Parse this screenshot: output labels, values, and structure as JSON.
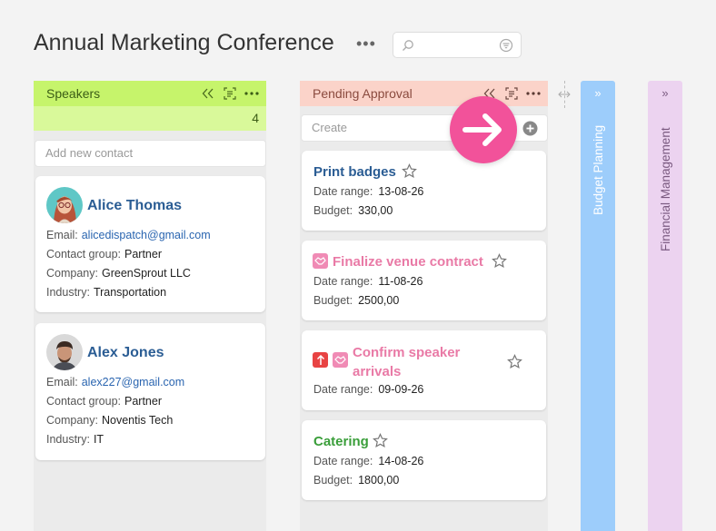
{
  "board": {
    "title": "Annual Marketing Conference",
    "menu_glyph": "•••",
    "search_placeholder": ""
  },
  "columns": {
    "speakers": {
      "title": "Speakers",
      "count": "4",
      "add_placeholder": "Add new contact",
      "color": "#c6f46b"
    },
    "pending": {
      "title": "Pending Approval",
      "create_placeholder": "Create",
      "color": "#fbd3c9"
    },
    "budget": {
      "title": "Budget Planning",
      "chevron": "»",
      "color": "#9dcdfb"
    },
    "financial": {
      "title": "Financial Management",
      "chevron": "»",
      "color": "#ecd3f0"
    }
  },
  "contacts": [
    {
      "name": "Alice Thomas",
      "email_label": "Email:",
      "email": "alicedispatch@gmail.com",
      "group_label": "Contact group:",
      "group": "Partner",
      "company_label": "Company:",
      "company": "GreenSprout LLC",
      "industry_label": "Industry:",
      "industry": "Transportation"
    },
    {
      "name": "Alex Jones",
      "email_label": "Email:",
      "email": "alex227@gmail.com",
      "group_label": "Contact group:",
      "group": "Partner",
      "company_label": "Company:",
      "company": "Noventis Tech",
      "industry_label": "Industry:",
      "industry": "IT"
    }
  ],
  "tasks": [
    {
      "title": "Print badges",
      "color": "#2b5d94",
      "date_label": "Date range:",
      "date": "13-08-26",
      "budget_label": "Budget:",
      "budget": "330,00"
    },
    {
      "title": "Finalize venue contract",
      "color": "#e97aa6",
      "date_label": "Date range:",
      "date": "11-08-26",
      "budget_label": "Budget:",
      "budget": "2500,00"
    },
    {
      "title_line1": "Confirm speaker",
      "title_line2": "arrivals",
      "color": "#e97aa6",
      "date_label": "Date range:",
      "date": "09-09-26"
    },
    {
      "title": "Catering",
      "color": "#3a9e3a",
      "date_label": "Date range:",
      "date": "14-08-26",
      "budget_label": "Budget:",
      "budget": "1800,00"
    }
  ]
}
